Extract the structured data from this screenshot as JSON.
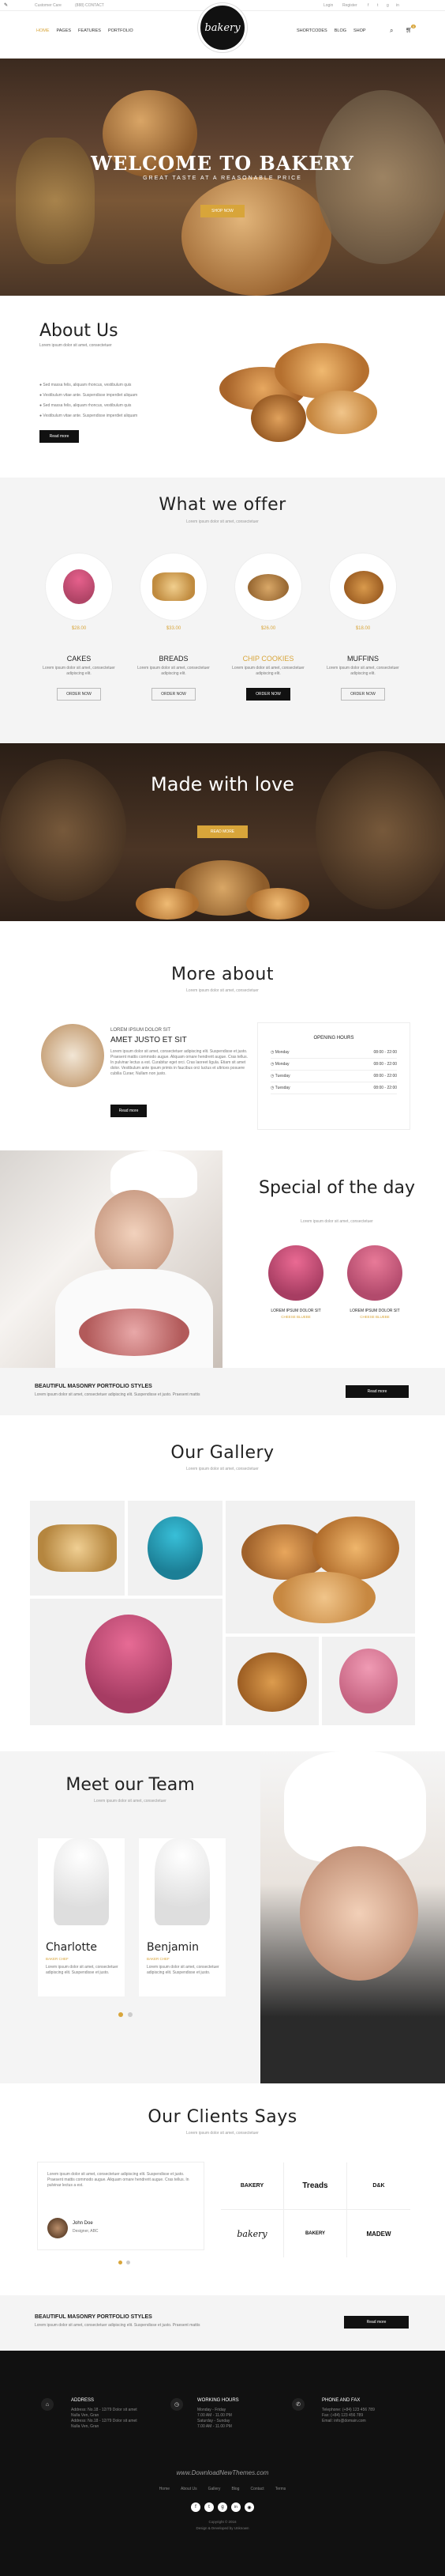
{
  "topbar": {
    "left_links": [
      "Customer Care",
      "(888) CONTACT"
    ],
    "right_links": [
      "Login",
      "Register"
    ]
  },
  "nav": {
    "left": [
      "HOME",
      "PAGES",
      "FEATURES",
      "PORTFOLIO"
    ],
    "right": [
      "SHORTCODES",
      "BLOG",
      "SHOP"
    ],
    "logo": "bakery",
    "cart_count": "0"
  },
  "hero": {
    "title": "WELCOME TO BAKERY",
    "subtitle": "GREAT TASTE AT A REASONABLE PRICE",
    "button": "SHOP NOW"
  },
  "about": {
    "title": "About Us",
    "subtitle": "Lorem ipsum dolor sit amet, consectetuer",
    "items": [
      "Sed massa felis, aliquam rhoncus, vestibulum quis",
      "Vestibulum vitae ante. Suspendisse imperdiet aliquam",
      "Sed massa felis, aliquam rhoncus, vestibulum quis",
      "Vestibulum vitae ante. Suspendisse imperdiet aliquam"
    ],
    "button": "Read more"
  },
  "offer": {
    "title": "What we offer",
    "subtitle": "Lorem ipsum dolor sit amet, consectetuer",
    "cards": [
      {
        "price": "$28.00",
        "name": "CAKES",
        "text": "Lorem ipsum dolor sit amet, consectetuer adipiscing elit.",
        "button": "ORDER NOW"
      },
      {
        "price": "$33.00",
        "name": "BREADS",
        "text": "Lorem ipsum dolor sit amet, consectetuer adipiscing elit.",
        "button": "ORDER NOW"
      },
      {
        "price": "$26.00",
        "name": "CHIP COOKIES",
        "text": "Lorem ipsum dolor sit amet, consectetuer adipiscing elit.",
        "button": "ORDER NOW"
      },
      {
        "price": "$18.00",
        "name": "MUFFINS",
        "text": "Lorem ipsum dolor sit amet, consectetuer adipiscing elit.",
        "button": "ORDER NOW"
      }
    ]
  },
  "love": {
    "title": "Made with love",
    "button": "READ MORE"
  },
  "more": {
    "title": "More about",
    "subtitle": "Lorem ipsum dolor sit amet, consectetuer",
    "kicker": "LOREM IPSUM DOLOR SIT",
    "heading": "AMET JUSTO ET SIT",
    "text": "Lorem ipsum dolor sit amet, consectetuer adipiscing elit. Suspendisse et justo. Praesent mattis commodo augue. Aliquam ornare hendrerit augue. Cras tellus. In pulvinar lectus a est. Curabitur eget orci. Cras laoreet ligula. Etiam sit amet dolor. Vestibulum ante ipsum primis in faucibus orci luctus et ultrices posuere cubilia Curae; Nullam non justo.",
    "button": "Read more",
    "hours_title": "OPENING HOURS",
    "hours": [
      {
        "day": "Monday",
        "time": "08:00 - 22:00"
      },
      {
        "day": "Monday",
        "time": "08:00 - 22:00"
      },
      {
        "day": "Tuesday",
        "time": "08:00 - 22:00"
      },
      {
        "day": "Tuesday",
        "time": "08:00 - 22:00"
      }
    ]
  },
  "special": {
    "title": "Special of the day",
    "subtitle": "Lorem ipsum dolor sit amet, consectetuer",
    "items": [
      {
        "name": "LOREM IPSUM DOLOR SIT",
        "price": "CHEESE BLUEBE"
      },
      {
        "name": "LOREM IPSUM DOLOR SIT",
        "price": "CHEESE BLUEBE"
      }
    ]
  },
  "strip1": {
    "title": "BEAUTIFUL MASONRY PORTFOLIO STYLES",
    "text": "Lorem ipsum dolor sit amet, consectetuer adipiscing elit. Suspendisse et justo. Praesent mattis",
    "button": "Read more"
  },
  "gallery": {
    "title": "Our Gallery",
    "subtitle": "Lorem ipsum dolor sit amet, consectetuer"
  },
  "team": {
    "title": "Meet our Team",
    "subtitle": "Lorem ipsum dolor sit amet, consectetuer",
    "members": [
      {
        "name": "Charlotte",
        "role": "BAKER CHEF",
        "text": "Lorem ipsum dolor sit amet, consectetuer adipiscing elit. Suspendisse et justo."
      },
      {
        "name": "Benjamin",
        "role": "BAKER CHEF",
        "text": "Lorem ipsum dolor sit amet, consectetuer adipiscing elit. Suspendisse et justo."
      }
    ]
  },
  "clients": {
    "title": "Our Clients Says",
    "subtitle": "Lorem ipsum dolor sit amet, consectetuer",
    "quote": "Lorem ipsum dolor sit amet, consectetuer adipiscing elit. Suspendisse et justo. Praesent mattis commodo augue. Aliquam ornare hendrerit augue. Cras tellus. In pulvinar lectus a est.",
    "author": "John Doe",
    "author_role": "Designer, ABC",
    "logos": [
      "BAKERY",
      "Treads",
      "D&K",
      "bakery",
      "BAKERY",
      "MADEW"
    ]
  },
  "strip2": {
    "title": "BEAUTIFUL MASONRY PORTFOLIO STYLES",
    "text": "Lorem ipsum dolor sit amet, consectetuer adipiscing elit. Suspendisse et justo. Praesent mattis",
    "button": "Read more"
  },
  "footer": {
    "cols": [
      {
        "title": "ADDRESS",
        "lines": [
          "Address: No.18 - 12/79 Dolor sit amet",
          "Nulla Ven, Gran",
          "Address: No.18 - 12/79 Dolor sit amet",
          "Nulla Ven, Gran"
        ]
      },
      {
        "title": "WORKING HOURS",
        "lines": [
          "Monday - Friday",
          "7.00 AM - 11.00 PM",
          "Saturday - Sunday",
          "7.00 AM - 11.00 PM"
        ]
      },
      {
        "title": "PHONE AND FAX",
        "lines": [
          "Telephone: (+84) 123 456 789",
          "Fax: (+84) 123 456 789",
          "Email: info@domain.com"
        ]
      }
    ],
    "watermark": "www.DownloadNewThemes.com",
    "links": [
      "Home",
      "About Us",
      "Gallery",
      "Blog",
      "Contact",
      "Terms"
    ],
    "copyright": "Copyright © 2016",
    "credit": "Design & Developed by Unknown"
  },
  "colors": {
    "accent": "#d8a53a",
    "dark": "#111111"
  }
}
